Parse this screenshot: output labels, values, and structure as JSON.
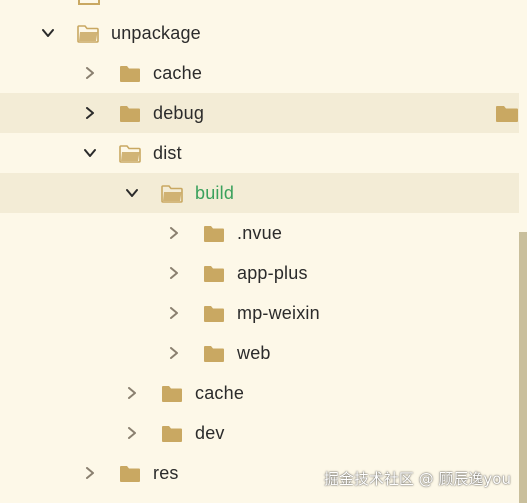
{
  "tree": {
    "rows": [
      {
        "name": "unpackage",
        "indent": 0,
        "expanded": true,
        "highlight": false,
        "green": false
      },
      {
        "name": "cache",
        "indent": 1,
        "expanded": false,
        "highlight": false,
        "green": false
      },
      {
        "name": "debug",
        "indent": 1,
        "expanded": false,
        "highlight": true,
        "green": false,
        "dark_chevron": true
      },
      {
        "name": "dist",
        "indent": 1,
        "expanded": true,
        "highlight": false,
        "green": false
      },
      {
        "name": "build",
        "indent": 2,
        "expanded": true,
        "highlight": true,
        "green": true
      },
      {
        "name": ".nvue",
        "indent": 3,
        "expanded": false,
        "highlight": false,
        "green": false
      },
      {
        "name": "app-plus",
        "indent": 3,
        "expanded": false,
        "highlight": false,
        "green": false
      },
      {
        "name": "mp-weixin",
        "indent": 3,
        "expanded": false,
        "highlight": false,
        "green": false
      },
      {
        "name": "web",
        "indent": 3,
        "expanded": false,
        "highlight": false,
        "green": false
      },
      {
        "name": "cache",
        "indent": 2,
        "expanded": false,
        "highlight": false,
        "green": false
      },
      {
        "name": "dev",
        "indent": 2,
        "expanded": false,
        "highlight": false,
        "green": false
      },
      {
        "name": "res",
        "indent": 1,
        "expanded": false,
        "highlight": false,
        "green": false
      }
    ]
  },
  "watermark": "掘金技术社区 @ 顾辰逸you",
  "colors": {
    "background": "#fdf8e8",
    "highlight": "#f3ecd6",
    "folder": "#c9a862",
    "chevron": "#8a8070",
    "chevron_dark": "#2b2b2b",
    "green_text": "#3aa15c",
    "scrollbar": "#c9bf9c"
  },
  "icons": {
    "collapsed": "chevron-right-icon",
    "expanded": "chevron-down-icon",
    "folder_closed": "folder-icon",
    "folder_open": "folder-open-icon"
  }
}
